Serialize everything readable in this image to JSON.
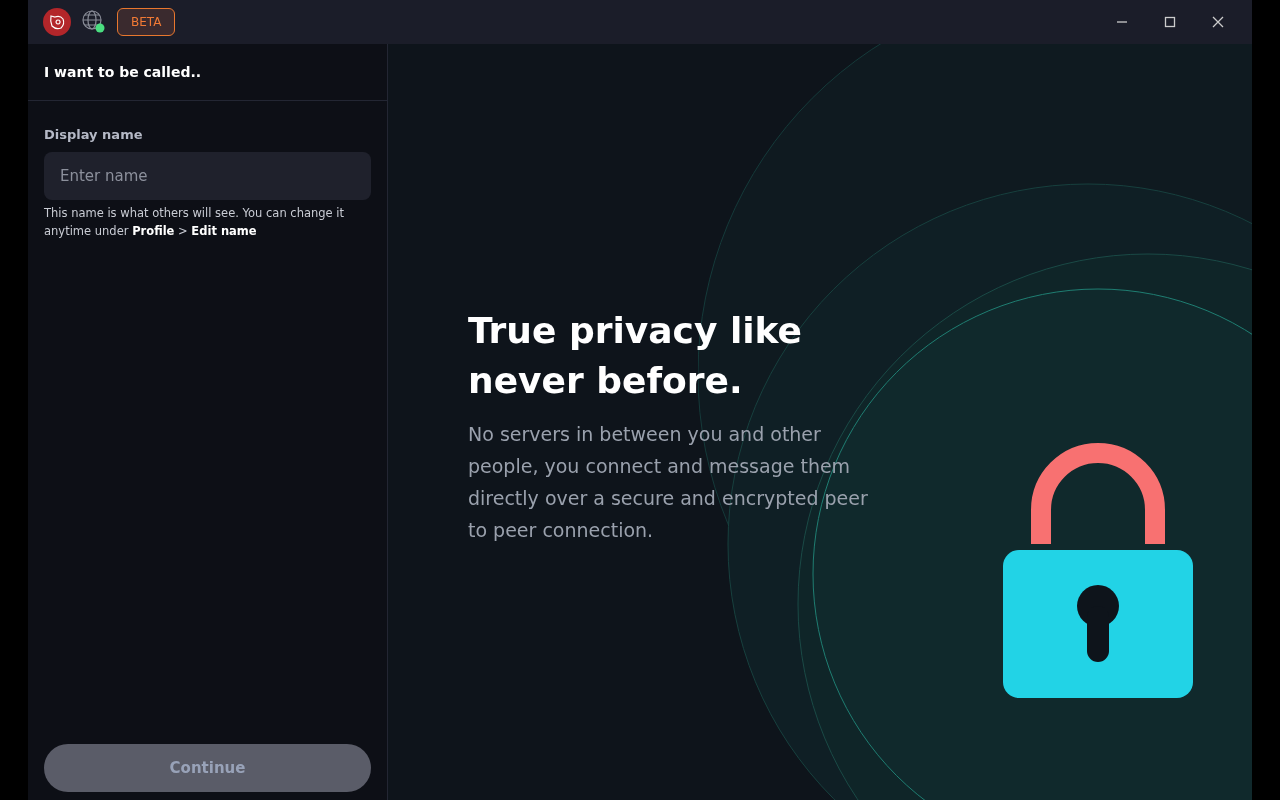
{
  "titlebar": {
    "badge": "BETA",
    "network_connected": true
  },
  "form": {
    "title": "I want to be called..",
    "field_label": "Display name",
    "placeholder": "Enter name",
    "hint": "This name is what others will see. You can change it anytime under **Profile** > **Edit name**",
    "button": {
      "label": "Continue",
      "disabled": true
    }
  },
  "hero": {
    "heading": "True privacy like never before.",
    "body": "No servers in between you and other people, you connect and message them directly over a secure and encrypted peer to peer connection."
  }
}
